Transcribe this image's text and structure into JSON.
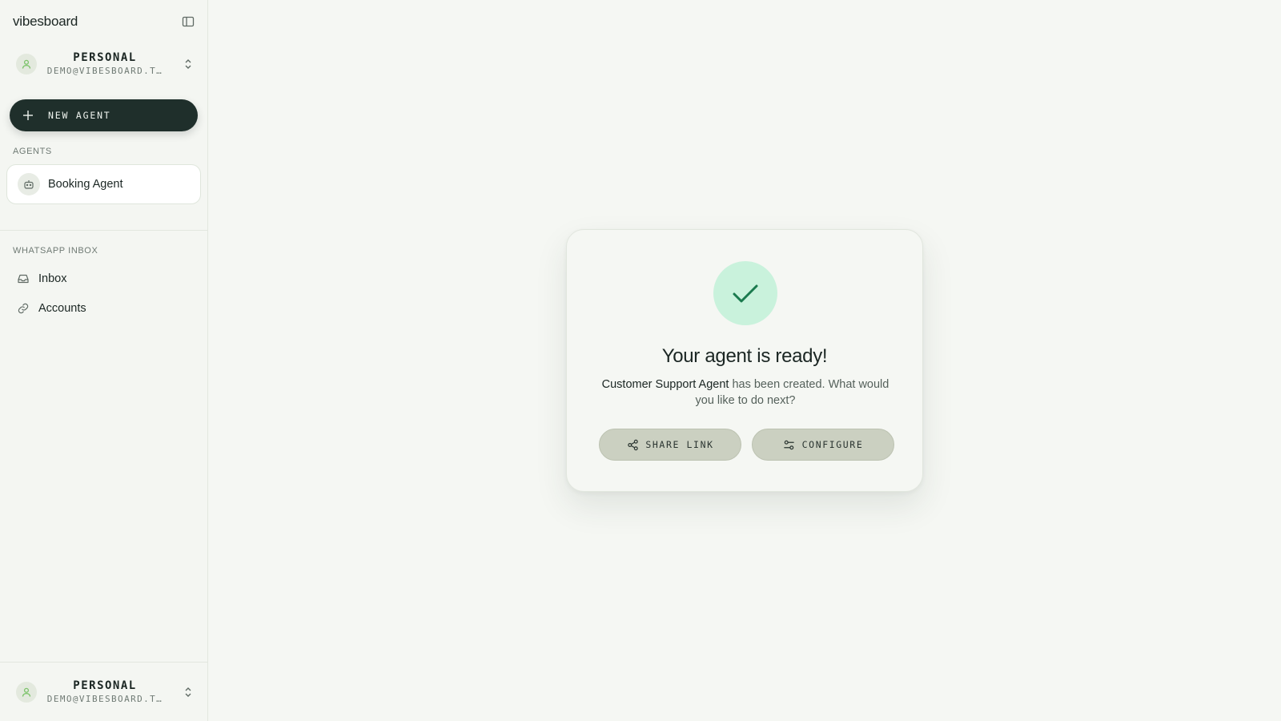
{
  "sidebar": {
    "brand": "vibesboard",
    "workspace_top": {
      "name": "PERSONAL",
      "email": "DEMO@VIBESBOARD.T…"
    },
    "new_agent_label": "NEW AGENT",
    "agents_section_label": "AGENTS",
    "agents": [
      {
        "name": "Booking Agent",
        "icon": "bot-icon"
      }
    ],
    "whatsapp_section_label": "WHATSAPP INBOX",
    "nav": [
      {
        "label": "Inbox",
        "icon": "inbox-icon"
      },
      {
        "label": "Accounts",
        "icon": "link-icon"
      }
    ],
    "workspace_bottom": {
      "name": "PERSONAL",
      "email": "DEMO@VIBESBOARD.T…"
    }
  },
  "main": {
    "dialog": {
      "icon": "check-icon",
      "title": "Your agent is ready!",
      "agent_name": "Customer Support Agent",
      "description_rest": " has been created. What would you like to do next?",
      "buttons": [
        {
          "label": "SHARE LINK",
          "icon": "share-icon"
        },
        {
          "label": "CONFIGURE",
          "icon": "sliders-icon"
        }
      ]
    }
  },
  "colors": {
    "background": "#f5f7f3",
    "primary_dark": "#1f2f2b",
    "success_circle": "#c9f2dc",
    "success_check": "#1a7a4e",
    "button_bg": "#cbd0c1"
  }
}
